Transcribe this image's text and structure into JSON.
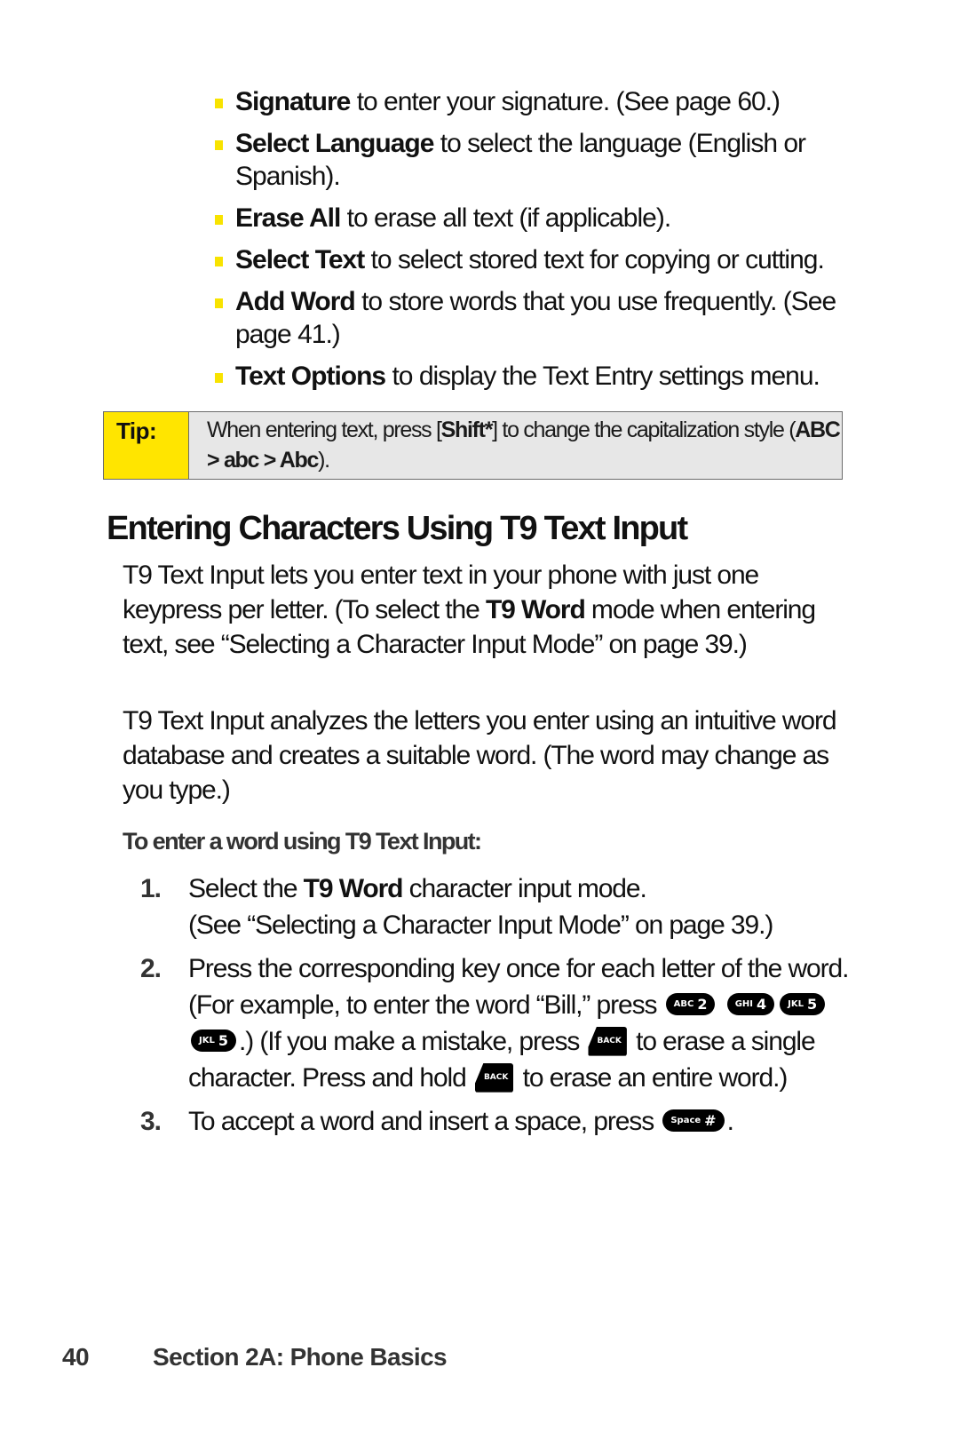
{
  "bullets": [
    {
      "term": "Signature",
      "text": " to enter your signature. (See page 60.)"
    },
    {
      "term": "Select Language",
      "text": " to select the language (English or Spanish)."
    },
    {
      "term": "Erase All",
      "text": " to erase all text (if applicable)."
    },
    {
      "term": "Select Text",
      "text": " to select stored text for copying or cutting."
    },
    {
      "term": "Add Word",
      "text": " to store words that you use frequently. (See page 41.)"
    },
    {
      "term": "Text Options",
      "text": " to display the Text Entry settings menu."
    }
  ],
  "tip": {
    "label": "Tip:",
    "pre": "When entering text, press [",
    "key": "Shift*",
    "mid": "] to change the capitalization style (",
    "styles": "ABC > abc > Abc",
    "post": ")."
  },
  "heading": "Entering Characters Using T9 Text Input",
  "paragraph1": {
    "pre": "T9 Text Input lets you enter text in your phone with just one keypress per letter. (To select the ",
    "bold": "T9 Word",
    "post": " mode when entering text, see “Selecting a Character Input Mode” on page 39.)"
  },
  "paragraph2": "T9 Text Input analyzes the letters you enter using an intuitive word database and creates a suitable word. (The word may change as you type.)",
  "subheading": "To enter a word using T9 Text Input:",
  "steps": [
    {
      "num": "1.",
      "pre": "Select the ",
      "bold": "T9 Word",
      "post": " character input mode.",
      "sub": "(See “Selecting a Character Input Mode” on page 39.)"
    },
    {
      "num": "2.",
      "a": "Press the corresponding key once for each letter of the word. (For example, to enter the word “Bill,” press ",
      "b": ".) (If you make a mistake, press ",
      "c": " to erase a single character. Press and hold ",
      "d": " to erase an entire word.)"
    },
    {
      "num": "3.",
      "a": "To accept a word and insert a space, press ",
      "b": "."
    }
  ],
  "keys": {
    "abc2": {
      "letters": "ABC",
      "digit": "2"
    },
    "ghi4": {
      "letters": "GHI",
      "digit": "4"
    },
    "jkl5": {
      "letters": "JKL",
      "digit": "5"
    },
    "back": {
      "label": "BACK"
    },
    "space": {
      "letters": "Space",
      "digit": "#"
    }
  },
  "footer": {
    "page_number": "40",
    "section": "Section 2A: Phone Basics"
  },
  "colors": {
    "accent_yellow": "#ffe500",
    "tip_background": "#e7e7e7"
  }
}
